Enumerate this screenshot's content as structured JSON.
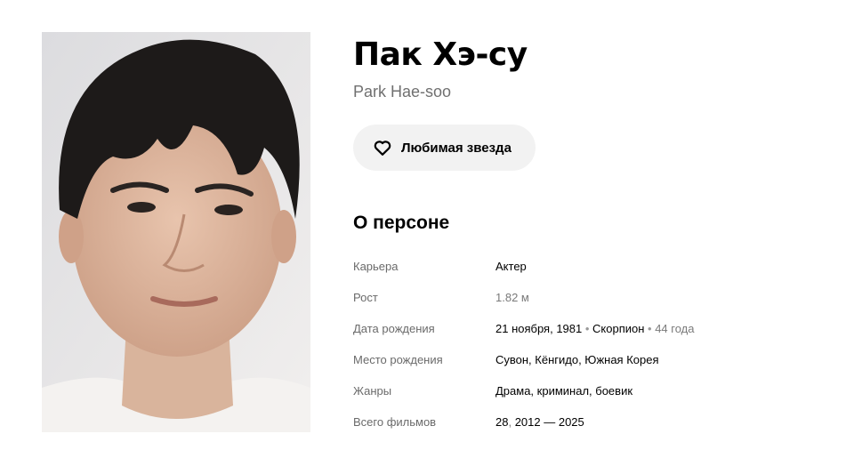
{
  "person": {
    "name": "Пак Хэ-су",
    "original_name": "Park Hae-soo"
  },
  "favorite_button": {
    "label": "Любимая звезда",
    "icon": "heart-outline-icon"
  },
  "about": {
    "title": "О персоне",
    "career": {
      "key": "Карьера",
      "value": "Актер"
    },
    "height": {
      "key": "Рост",
      "value": "1.82 м"
    },
    "birth": {
      "key": "Дата рождения",
      "date": "21 ноября, 1981",
      "sign": "Скорпион",
      "age": "44 года"
    },
    "birthplace": {
      "key": "Место рождения",
      "value": "Сувон, Кёнгидо, Южная Корея"
    },
    "genres": {
      "key": "Жанры",
      "value": "Драма, криминал, боевик"
    },
    "films": {
      "key": "Всего фильмов",
      "count": "28",
      "years": "2012 — 2025"
    }
  },
  "colors": {
    "button_bg": "#f2f2f2",
    "muted_text": "#6a6a6a"
  }
}
